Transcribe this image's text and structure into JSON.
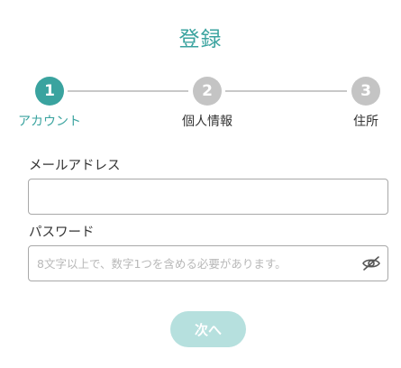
{
  "page": {
    "title": "登録"
  },
  "stepper": {
    "steps": [
      {
        "number": "1",
        "label": "アカウント",
        "state": "active"
      },
      {
        "number": "2",
        "label": "個人情報",
        "state": "inactive"
      },
      {
        "number": "3",
        "label": "住所",
        "state": "inactive"
      }
    ]
  },
  "form": {
    "email": {
      "label": "メールアドレス",
      "value": "",
      "placeholder": ""
    },
    "password": {
      "label": "パスワード",
      "value": "",
      "placeholder": "8文字以上で、数字1つを含める必要があります。",
      "toggle_icon": "eye-off-icon"
    },
    "next_label": "次へ"
  },
  "colors": {
    "accent": "#3aa39f",
    "inactive_step": "#c4c4c4",
    "button_disabled": "#b6e0de"
  }
}
